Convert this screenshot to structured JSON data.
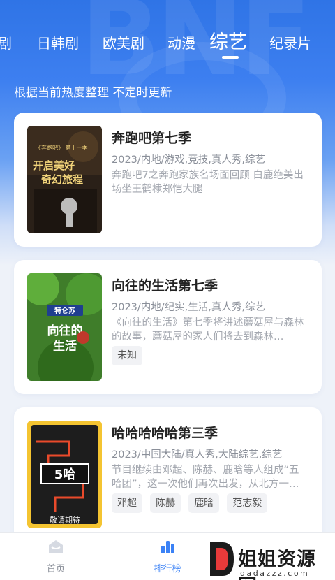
{
  "tabs": [
    {
      "label": "剧"
    },
    {
      "label": "日韩剧"
    },
    {
      "label": "欧美剧"
    },
    {
      "label": "动漫"
    },
    {
      "label": "综艺"
    },
    {
      "label": "纪录片"
    }
  ],
  "active_tab": "综艺",
  "subtitle": "根据当前热度整理 不定时更新",
  "cards": [
    {
      "title": "奔跑吧第七季",
      "meta": "2023/内地/游戏,竞技,真人秀,综艺",
      "desc": "奔跑吧7之奔跑家族名场面回顾 白鹿绝美出场坐王鹤棣郑恺大腿",
      "tags": [],
      "poster": {
        "top": "《奔跑吧》 第十一季",
        "main": "开启美好奇幻旅程"
      }
    },
    {
      "title": "向往的生活第七季",
      "meta": "2023/内地/纪实,生活,真人秀,综艺",
      "desc": "《向往的生活》第七季将讲述蘑菇屋与森林的故事，蘑菇屋的家人们将去到森林…",
      "tags": [
        "未知"
      ],
      "poster": {
        "top": "特仑苏",
        "main": "向往的生活"
      }
    },
    {
      "title": "哈哈哈哈哈第三季",
      "meta": "2023/中国大陆/真人秀,大陆综艺,综艺",
      "desc": "节目继续由邓超、陈赫、鹿晗等人组成“五哈团”，这一次他们再次出发，从北方一…",
      "tags": [
        "邓超",
        "陈赫",
        "鹿晗",
        "范志毅"
      ],
      "poster": {
        "top": "5哈",
        "main": "敬请期待"
      }
    }
  ],
  "bottom_nav": [
    {
      "label": "首页",
      "icon": "home-icon",
      "active": false
    },
    {
      "label": "排行榜",
      "icon": "bar-chart-icon",
      "active": true
    }
  ],
  "watermark": {
    "text": "姐姐资源网",
    "sub": "dadazzz.com"
  },
  "colors": {
    "accent": "#2f74e6",
    "active_nav": "#3b82f6",
    "inactive_nav": "#8a8f99"
  }
}
